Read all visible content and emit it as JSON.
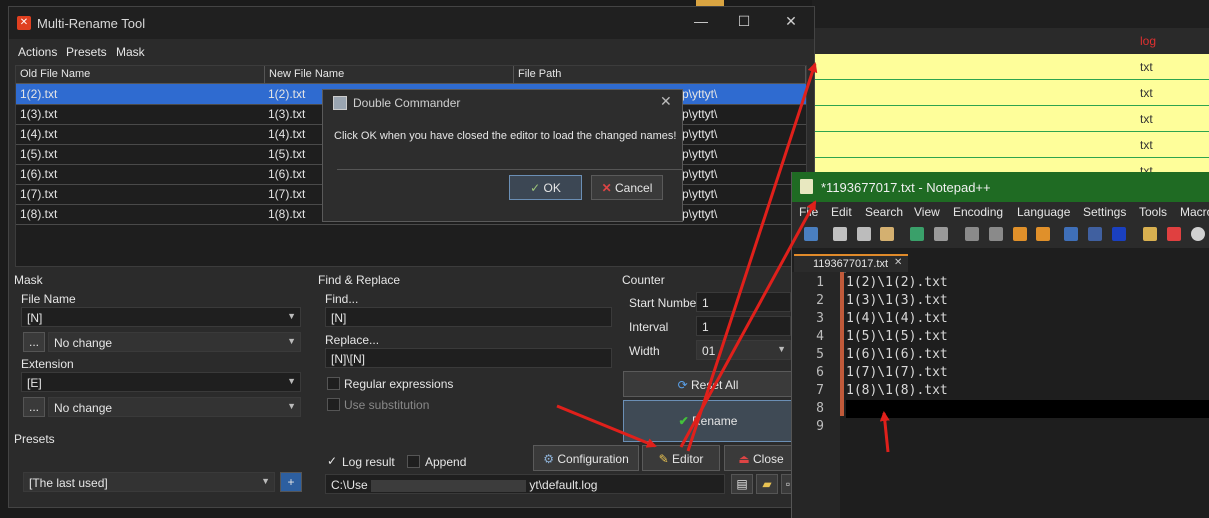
{
  "background_app": {
    "header_text": "log",
    "rows": [
      "txt",
      "txt",
      "txt",
      "txt",
      "txt"
    ]
  },
  "mrt": {
    "title": "Multi-Rename Tool",
    "menu": [
      "Actions",
      "Presets",
      "Mask"
    ],
    "columns": [
      "Old File Name",
      "New File Name",
      "File Path"
    ],
    "rows": [
      {
        "old": "1(2).txt",
        "new": "1(2).txt",
        "path": "p\\yttyt\\"
      },
      {
        "old": "1(3).txt",
        "new": "1(3).txt",
        "path": "p\\yttyt\\"
      },
      {
        "old": "1(4).txt",
        "new": "1(4).txt",
        "path": "p\\yttyt\\"
      },
      {
        "old": "1(5).txt",
        "new": "1(5).txt",
        "path": "p\\yttyt\\"
      },
      {
        "old": "1(6).txt",
        "new": "1(6).txt",
        "path": "p\\yttyt\\"
      },
      {
        "old": "1(7).txt",
        "new": "1(7).txt",
        "path": "p\\yttyt\\"
      },
      {
        "old": "1(8).txt",
        "new": "1(8).txt",
        "path": "p\\yttyt\\"
      }
    ],
    "mask": {
      "label": "Mask",
      "file_name_label": "File Name",
      "file_name_value": "[N]",
      "file_name_case": "No change",
      "extension_label": "Extension",
      "extension_value": "[E]",
      "extension_case": "No change",
      "ellipsis": "..."
    },
    "presets": {
      "label": "Presets",
      "value": "[The last used]"
    },
    "find_replace": {
      "label": "Find & Replace",
      "find_label": "Find...",
      "find_value": "[N]",
      "replace_label": "Replace...",
      "replace_value": "[N]\\[N]",
      "regex_label": "Regular expressions",
      "subst_label": "Use substitution"
    },
    "counter": {
      "label": "Counter",
      "start_label": "Start Number",
      "start_value": "1",
      "interval_label": "Interval",
      "interval_value": "1",
      "width_label": "Width",
      "width_value": "01"
    },
    "buttons": {
      "reset_all": "Reset All",
      "rename": "Rename",
      "configuration": "Configuration",
      "editor": "Editor",
      "close": "Close"
    },
    "log": {
      "log_result": "Log result",
      "append": "Append",
      "path_prefix": "C:\\Use",
      "path_suffix": "yt\\default.log"
    }
  },
  "dialog": {
    "title": "Double Commander",
    "message": "Click OK when you have closed the editor to load the changed names!",
    "ok": "OK",
    "cancel": "Cancel"
  },
  "npp": {
    "title": "*1193677017.txt - Notepad++",
    "menu": [
      "File",
      "Edit",
      "Search",
      "View",
      "Encoding",
      "Language",
      "Settings",
      "Tools",
      "Macro"
    ],
    "tab": "1193677017.txt",
    "lines": [
      "1(2)\\1(2).txt",
      "1(3)\\1(3).txt",
      "1(4)\\1(4).txt",
      "1(5)\\1(5).txt",
      "1(6)\\1(6).txt",
      "1(7)\\1(7).txt",
      "1(8)\\1(8).txt",
      "",
      ""
    ],
    "line_numbers": [
      "1",
      "2",
      "3",
      "4",
      "5",
      "6",
      "7",
      "8",
      "9"
    ]
  },
  "colors": {
    "selection": "#2f6bd0",
    "npp_title": "#1f6b23",
    "annotation_arrow": "#e0201b",
    "highlight_rows": "#fefe9a"
  }
}
